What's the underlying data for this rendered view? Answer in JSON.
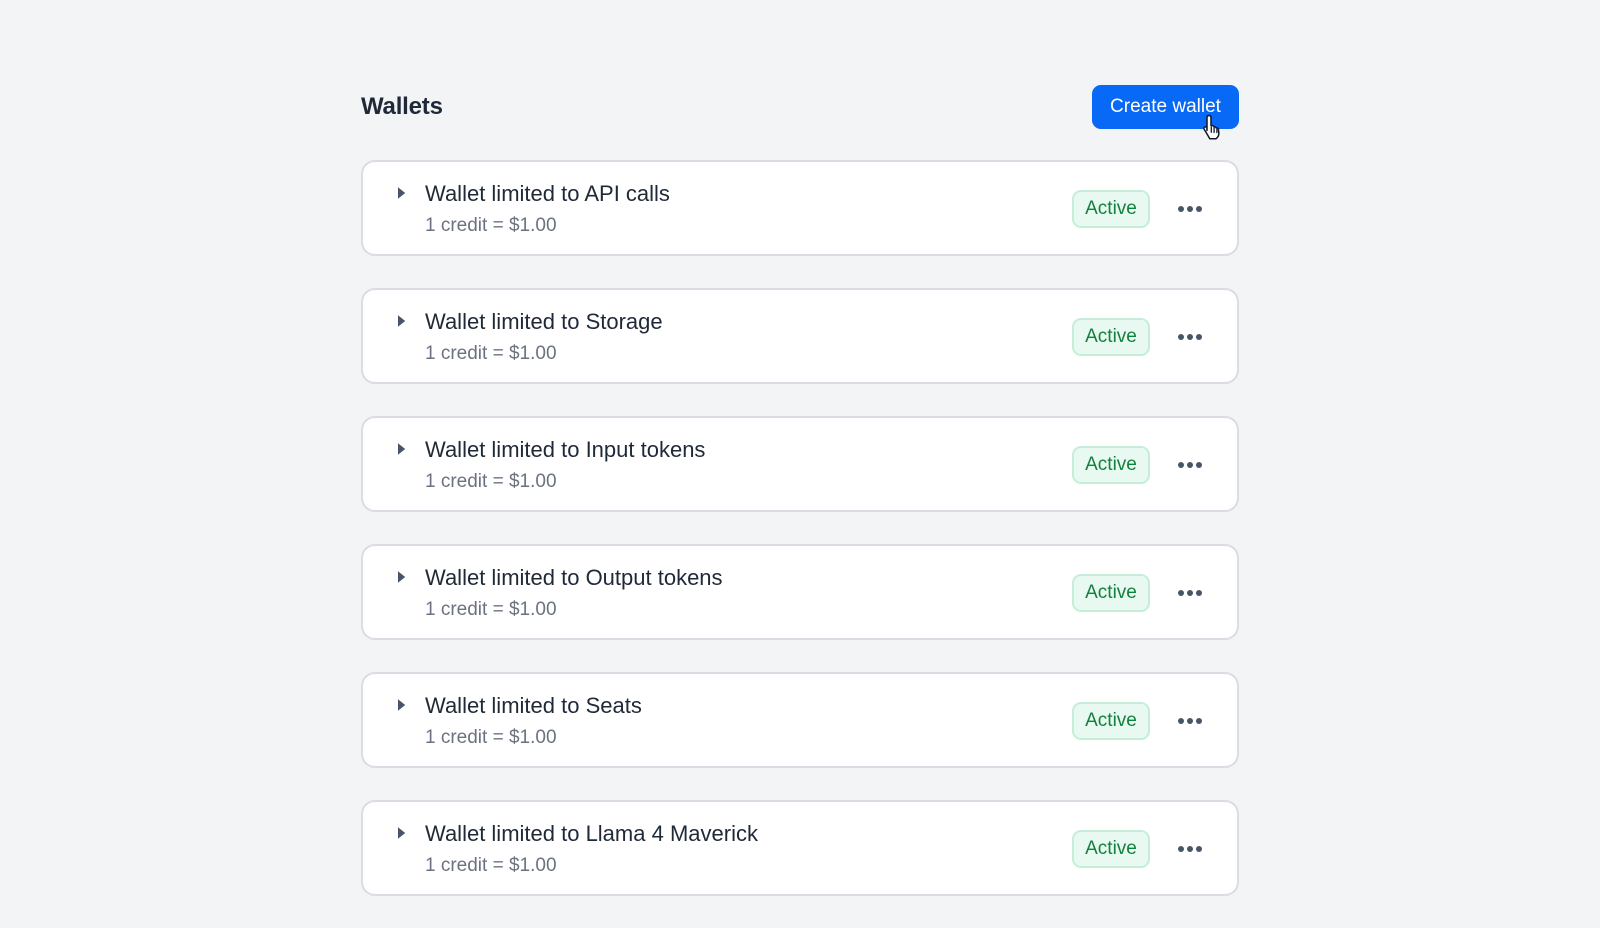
{
  "header": {
    "title": "Wallets",
    "create_button_label": "Create wallet"
  },
  "wallets": [
    {
      "name": "Wallet limited to API calls",
      "rate": "1 credit = $1.00",
      "status": "Active"
    },
    {
      "name": "Wallet limited to Storage",
      "rate": "1 credit = $1.00",
      "status": "Active"
    },
    {
      "name": "Wallet limited to Input tokens",
      "rate": "1 credit = $1.00",
      "status": "Active"
    },
    {
      "name": "Wallet limited to Output tokens",
      "rate": "1 credit = $1.00",
      "status": "Active"
    },
    {
      "name": "Wallet limited to Seats",
      "rate": "1 credit = $1.00",
      "status": "Active"
    },
    {
      "name": "Wallet limited to Llama 4 Maverick",
      "rate": "1 credit = $1.00",
      "status": "Active"
    }
  ],
  "icons": {
    "expand": "caret-right-icon",
    "more": "more-horizontal-icon",
    "cursor": "hand-pointer-icon"
  },
  "colors": {
    "background": "#f3f4f6",
    "primary_button": "#0969f7",
    "status_active_text": "#15803d",
    "status_active_bg": "#e7f9f0"
  }
}
